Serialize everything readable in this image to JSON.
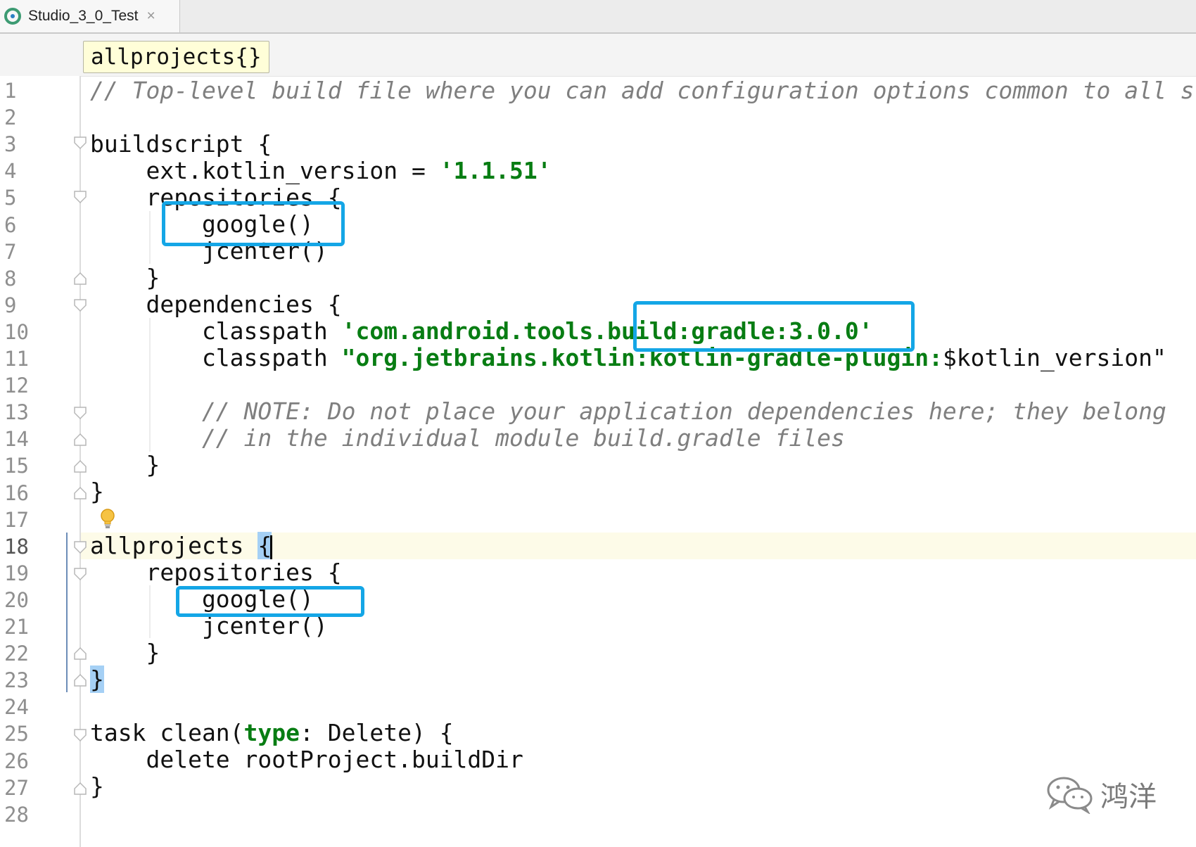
{
  "tab": {
    "title": "Studio_3_0_Test",
    "close_symbol": "×",
    "icon": "android-studio-icon"
  },
  "breadcrumb": {
    "label": "allprojects{}"
  },
  "editor": {
    "caret_line": 18,
    "line_numbers": [
      "1",
      "2",
      "3",
      "4",
      "5",
      "6",
      "7",
      "8",
      "9",
      "10",
      "11",
      "12",
      "13",
      "14",
      "15",
      "16",
      "17",
      "18",
      "19",
      "20",
      "21",
      "22",
      "23",
      "24",
      "25",
      "26",
      "27",
      "28"
    ],
    "lines": {
      "l1": "// Top-level build file where you can add configuration options common to all s",
      "l3": "buildscript {",
      "l4_code": "    ext.kotlin_version = ",
      "l4_str": "'1.1.51'",
      "l5": "    repositories {",
      "l6": "        google()",
      "l7": "        jcenter()",
      "l8": "    }",
      "l9": "    dependencies {",
      "l10_code": "        classpath ",
      "l10_str": "'com.android.tools.build:gradle:3.0.0'",
      "l11_code": "        classpath ",
      "l11_str": "\"org.jetbrains.kotlin:kotlin-gradle-plugin:",
      "l11_var": "$kotlin_version\"",
      "l13": "        // NOTE: Do not place your application dependencies here; they belong",
      "l14": "        // in the individual module build.gradle files",
      "l15": "    }",
      "l16": "}",
      "l18_code": "allprojects ",
      "l18_brace": "{",
      "l19": "    repositories {",
      "l20": "        google()",
      "l21": "        jcenter()",
      "l22": "    }",
      "l23": "}",
      "l25_a": "task clean(",
      "l25_kw": "type",
      "l25_b": ": Delete) {",
      "l26": "    delete rootProject.buildDir",
      "l27": "}"
    }
  },
  "colors": {
    "highlight_box": "#14a6e6",
    "string": "#087d13",
    "comment": "#7f7f7f",
    "current_line": "#fdfbe8"
  },
  "watermark": {
    "text": "鸿洋",
    "icon": "wechat-icon"
  }
}
